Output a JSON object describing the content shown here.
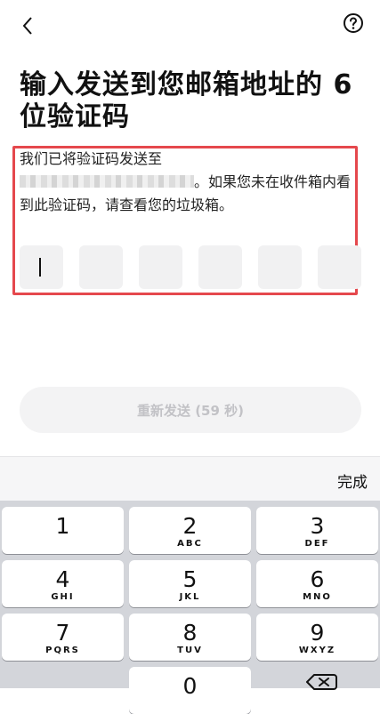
{
  "header": {
    "back_icon": "chevron-left-icon",
    "help_icon": "question-circle-icon"
  },
  "title": "输入发送到您邮箱地址的 6 位验证码",
  "description": {
    "line_start": "我们已将验证码发送至",
    "line_end": "。如果您未在收件箱内看到此验证码，请查看您的垃圾箱。"
  },
  "code_input": {
    "digits_visible": 6,
    "active_index": 0
  },
  "resend_button": {
    "label": "重新发送 (59 秒)"
  },
  "keyboard": {
    "done_label": "完成",
    "keys": [
      {
        "digit": "1",
        "letters": ""
      },
      {
        "digit": "2",
        "letters": "ABC"
      },
      {
        "digit": "3",
        "letters": "DEF"
      },
      {
        "digit": "4",
        "letters": "GHI"
      },
      {
        "digit": "5",
        "letters": "JKL"
      },
      {
        "digit": "6",
        "letters": "MNO"
      },
      {
        "digit": "7",
        "letters": "PQRS"
      },
      {
        "digit": "8",
        "letters": "TUV"
      },
      {
        "digit": "9",
        "letters": "WXYZ"
      },
      {
        "digit": "0",
        "letters": ""
      }
    ]
  },
  "colors": {
    "highlight_border": "#e5484d",
    "code_box_bg": "#f1f1f2",
    "keyboard_bg": "#d3d5da"
  }
}
